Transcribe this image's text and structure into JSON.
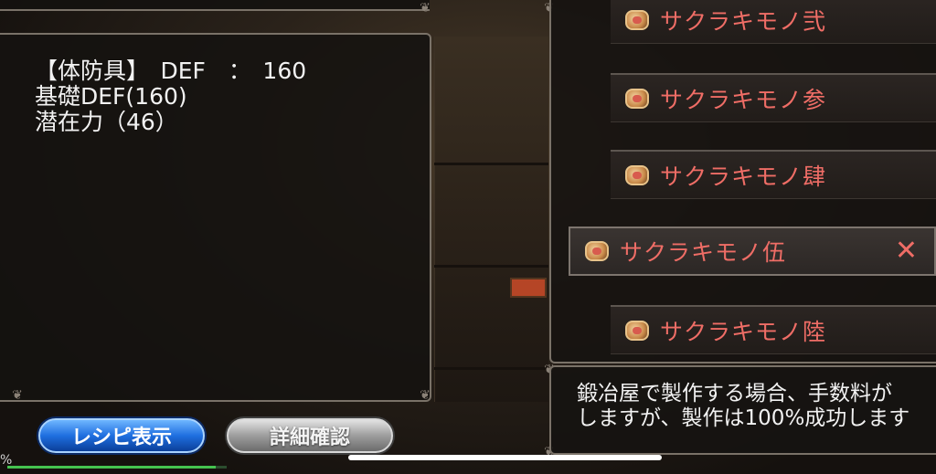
{
  "equipment": {
    "type_line": "【体防具】　DEF　：　160",
    "base_def": "基礎DEF(160)",
    "potential": "潜在力（46）"
  },
  "recipe_list": [
    {
      "label": "サクラキモノ弐",
      "selected": false
    },
    {
      "label": "サクラキモノ参",
      "selected": false
    },
    {
      "label": "サクラキモノ肆",
      "selected": false
    },
    {
      "label": "サクラキモノ伍",
      "selected": true
    },
    {
      "label": "サクラキモノ陸",
      "selected": false
    }
  ],
  "remove_symbol": "✕",
  "info": {
    "line1": "鍛冶屋で製作する場合、手数料が",
    "line2": "しますが、製作は100%成功します"
  },
  "buttons": {
    "recipe": "レシピ表示",
    "detail": "詳細確認"
  },
  "edge_mark": "%",
  "progress": 0.95,
  "colors": {
    "item_text": "#ef6d66",
    "recipe_button": "#1f6fe0",
    "detail_button": "#9d9d9d"
  }
}
